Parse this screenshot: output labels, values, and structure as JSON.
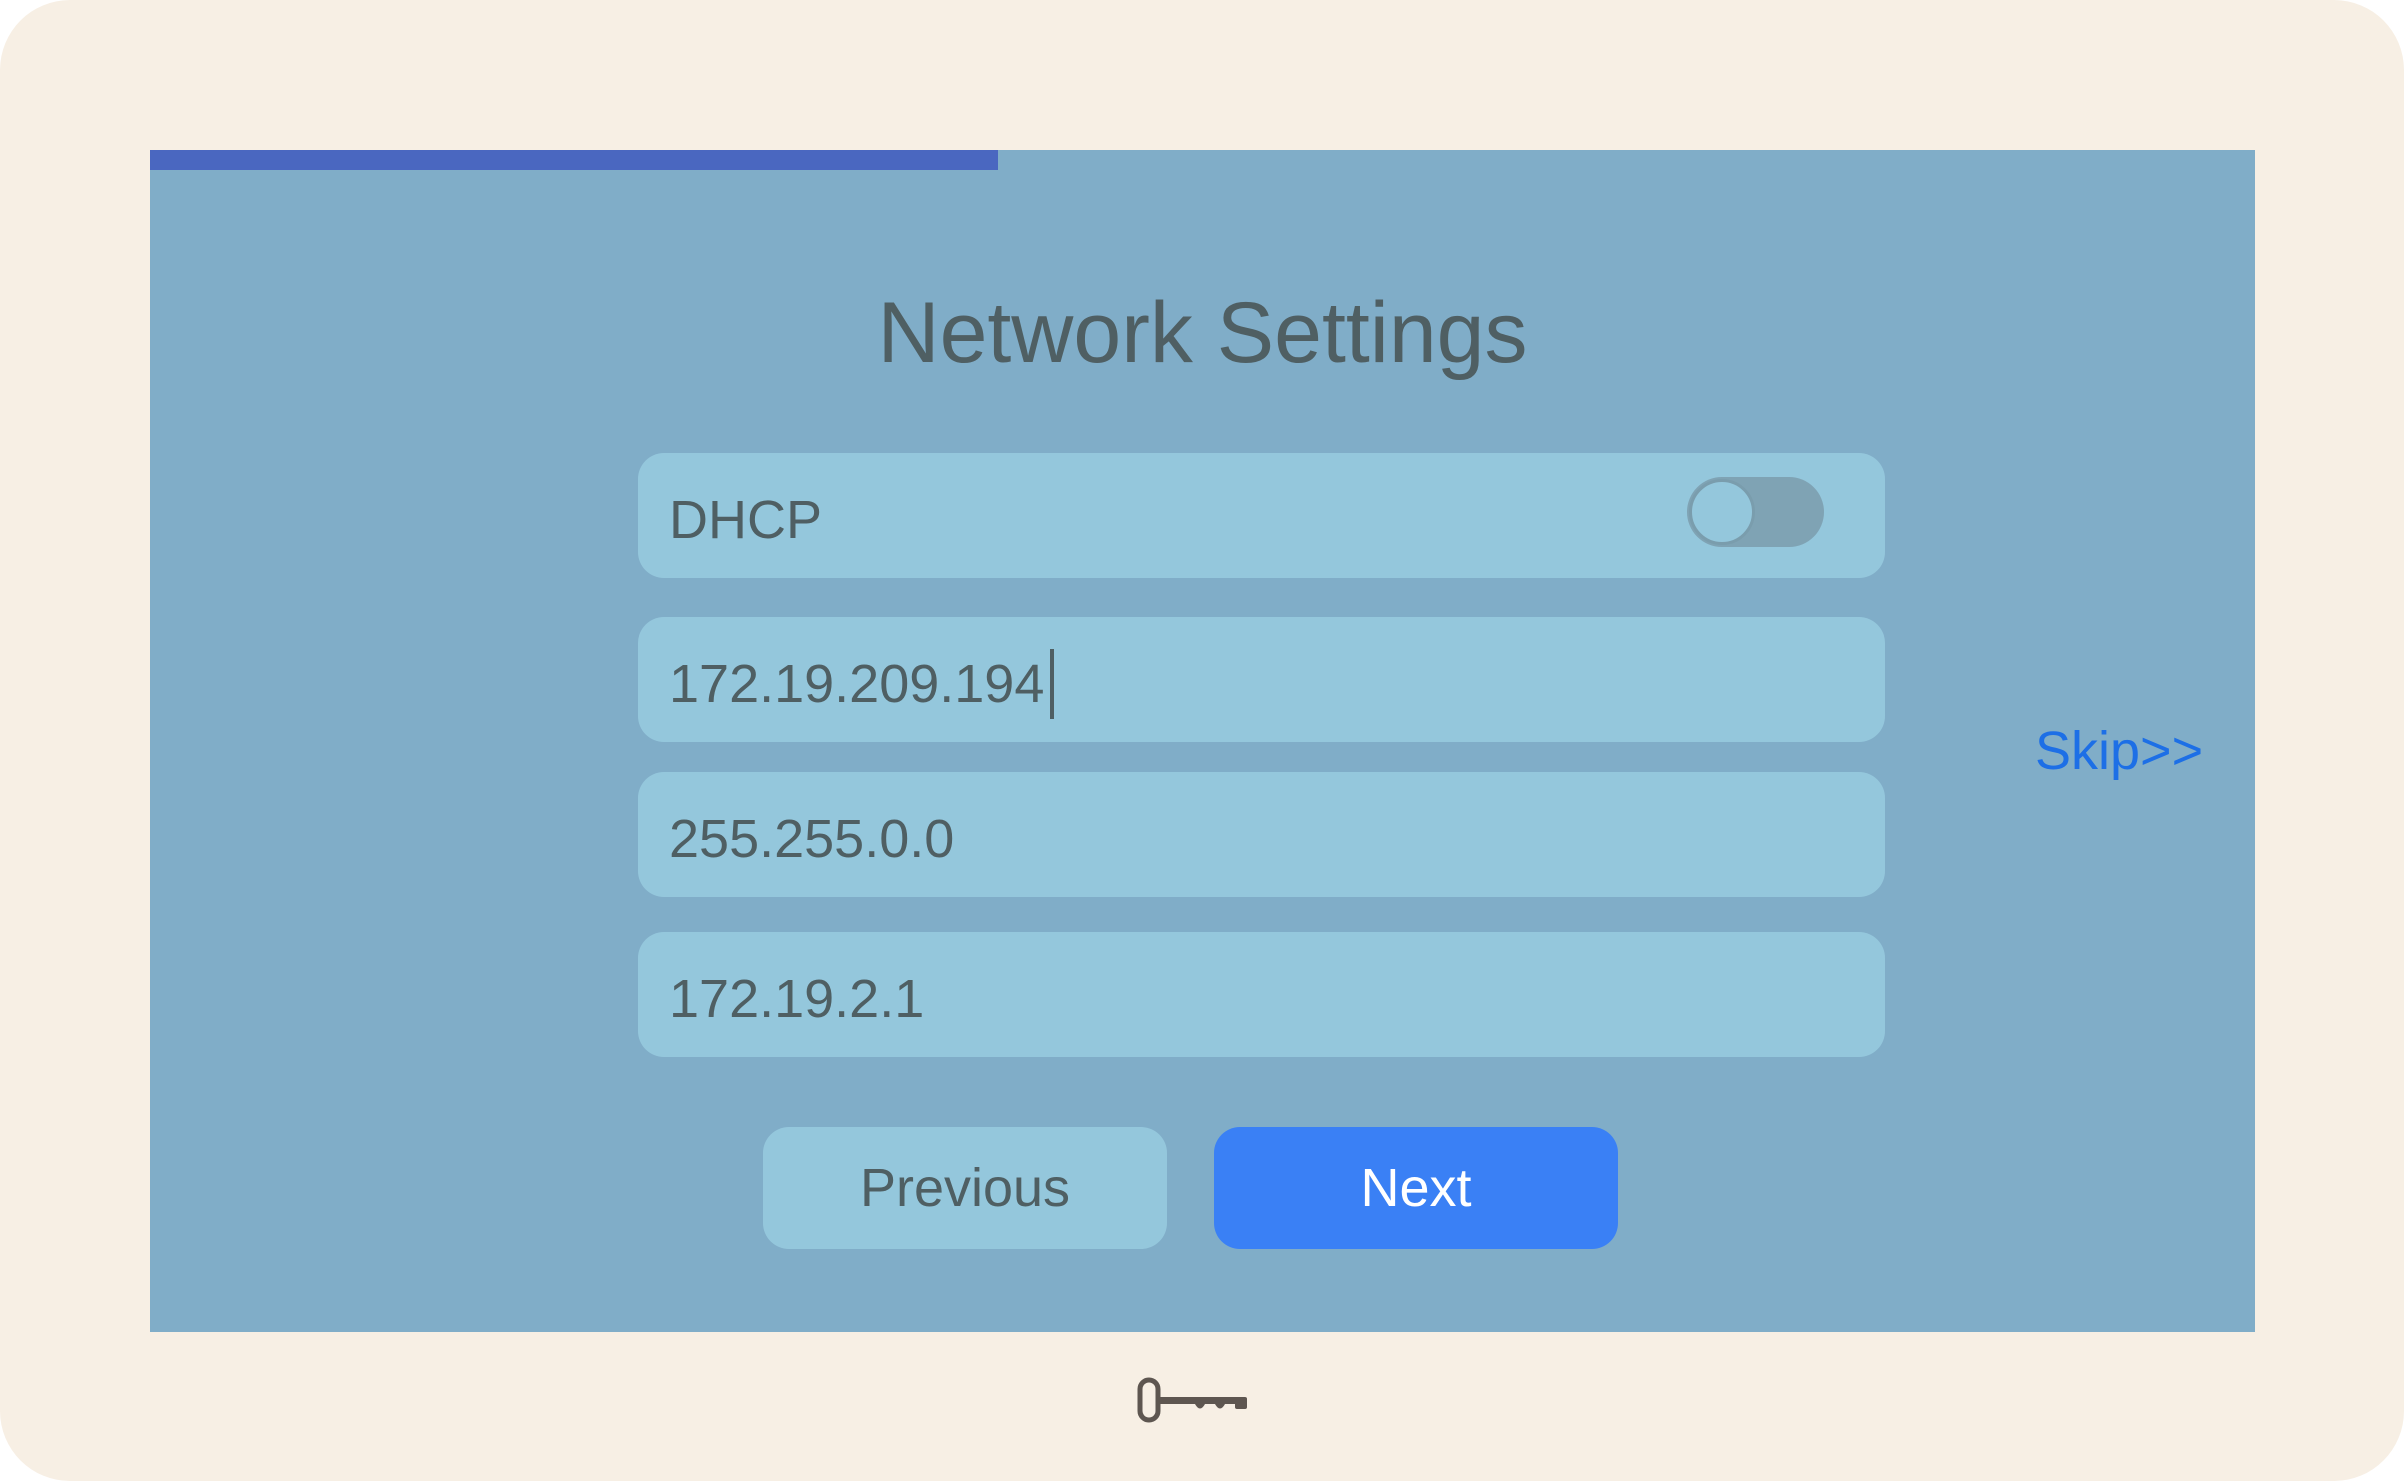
{
  "onboarding": {
    "progress_fraction": 0.403
  },
  "page": {
    "title": "Network Settings"
  },
  "form": {
    "dhcp_label": "DHCP",
    "dhcp_enabled": false,
    "ip_address": "172.19.209.194",
    "subnet_mask": "255.255.0.0",
    "gateway": "172.19.2.1"
  },
  "actions": {
    "skip_label": "Skip>>",
    "previous_label": "Previous",
    "next_label": "Next"
  },
  "colors": {
    "bezel": "#f7efe4",
    "screen": "#80adc8",
    "field": "#94c7dc",
    "progress": "#4a67c0",
    "primary_button": "#3a80f5",
    "link": "#1d6fe6",
    "text": "#4f5f63"
  },
  "icons": {
    "bottom_bezel": "key-icon"
  }
}
